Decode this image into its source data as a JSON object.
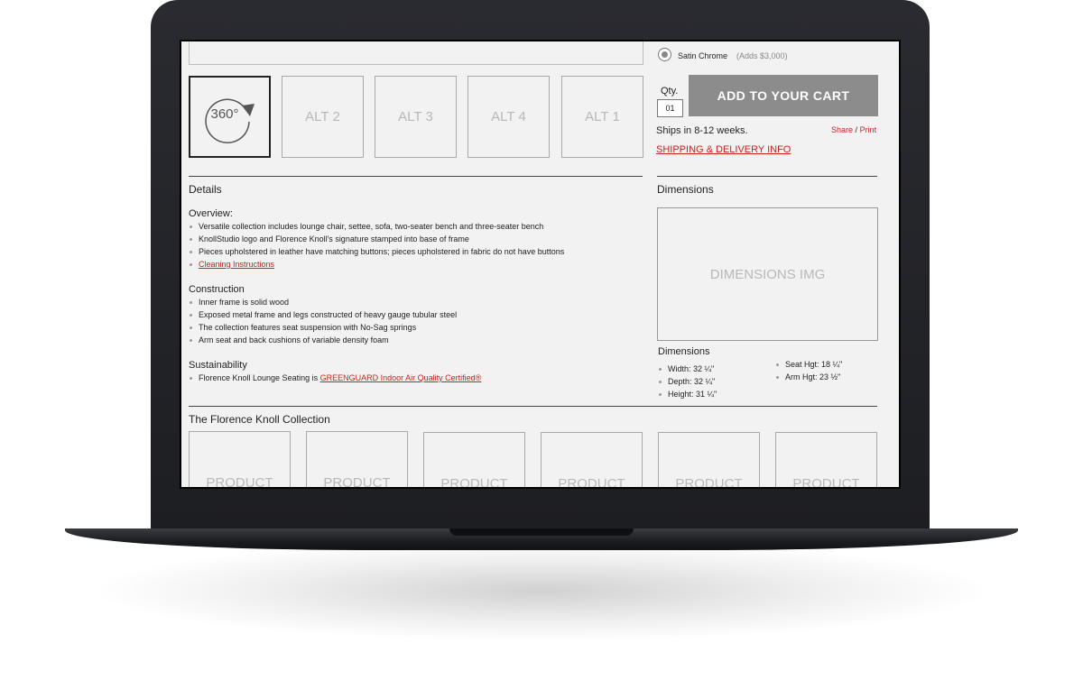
{
  "option": {
    "label": "Satin Chrome",
    "note": "(Adds $3,000)"
  },
  "gallery": {
    "spin_label": "360°",
    "alts": [
      "ALT 2",
      "ALT 3",
      "ALT 4",
      "ALT 1"
    ]
  },
  "purchase": {
    "qty_label": "Qty.",
    "qty_value": "01",
    "cart_button": "ADD TO YOUR CART",
    "ships": "Ships in 8-12 weeks.",
    "share": "Share",
    "share_sep": "/",
    "print": "Print",
    "shipping_link": "SHIPPING & DELIVERY INFO"
  },
  "details": {
    "title": "Details",
    "overview": {
      "title": "Overview:",
      "items": [
        "Versatile collection includes lounge chair, settee, sofa, two-seater bench and three-seater bench",
        "KnollStudio logo and Florence Knoll's signature stamped into base of frame",
        "Pieces upholstered in leather have matching buttons; pieces upholstered in fabric do not have buttons"
      ],
      "link": "Cleaning Instructions"
    },
    "construction": {
      "title": "Construction",
      "items": [
        "Inner frame is solid wood",
        "Exposed metal frame and legs constructed of heavy gauge tubular steel",
        "The collection features seat suspension with No-Sag springs",
        "Arm seat and back cushions of variable density foam"
      ]
    },
    "sustainability": {
      "title": "Sustainability",
      "text": "Florence Knoll Lounge Seating is ",
      "link": "GREENGUARD Indoor Air Quality Certified®"
    }
  },
  "dimensions": {
    "title": "Dimensions",
    "image_label": "DIMENSIONS IMG",
    "subtitle": "Dimensions",
    "left": [
      "Width: 32 ¼\"",
      "Depth: 32 ¼\"",
      "Height: 31 ¼\""
    ],
    "right": [
      "Seat Hgt: 18 ¼\"",
      "Arm Hgt: 23 ½\""
    ]
  },
  "collection": {
    "title": "The Florence Knoll Collection",
    "products": [
      "PRODUCT",
      "PRODUCT",
      "PRODUCT",
      "PRODUCT",
      "PRODUCT",
      "PRODUCT"
    ]
  }
}
